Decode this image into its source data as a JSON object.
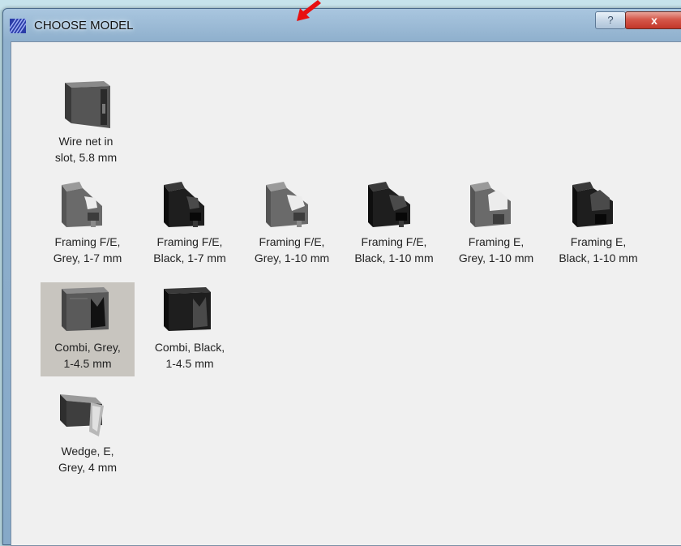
{
  "window": {
    "title": "CHOOSE MODEL",
    "help_label": "?",
    "close_label": "x"
  },
  "models": [
    {
      "id": "wire-net",
      "line1": "Wire net in",
      "line2": "slot, 5.8 mm",
      "color": "#555555",
      "icon": "wire-net-profile-icon"
    },
    {
      "id": "framing-fe-grey-1-7",
      "line1": "Framing F/E,",
      "line2": "Grey, 1-7 mm",
      "color": "#6a6a6a",
      "icon": "framing-profile-icon"
    },
    {
      "id": "framing-fe-black-1-7",
      "line1": "Framing F/E,",
      "line2": "Black, 1-7 mm",
      "color": "#1e1e1e",
      "icon": "framing-profile-icon"
    },
    {
      "id": "framing-fe-grey-1-10",
      "line1": "Framing F/E,",
      "line2": "Grey, 1-10 mm",
      "color": "#6a6a6a",
      "icon": "framing-profile-icon"
    },
    {
      "id": "framing-fe-black-1-10",
      "line1": "Framing F/E,",
      "line2": "Black, 1-10 mm",
      "color": "#1e1e1e",
      "icon": "framing-profile-icon"
    },
    {
      "id": "framing-e-grey-1-10",
      "line1": "Framing E,",
      "line2": "Grey, 1-10 mm",
      "color": "#6a6a6a",
      "icon": "framing-profile-icon"
    },
    {
      "id": "framing-e-black-1-10",
      "line1": "Framing E,",
      "line2": "Black, 1-10 mm",
      "color": "#1e1e1e",
      "icon": "framing-profile-icon"
    },
    {
      "id": "combi-grey",
      "line1": "Combi, Grey,",
      "line2": "1-4.5 mm",
      "color": "#5a5a5a",
      "icon": "combi-profile-icon",
      "selected": true
    },
    {
      "id": "combi-black",
      "line1": "Combi, Black,",
      "line2": "1-4.5 mm",
      "color": "#1e1e1e",
      "icon": "combi-profile-icon"
    },
    {
      "id": "wedge-e-grey",
      "line1": "Wedge, E,",
      "line2": "Grey, 4 mm",
      "color": "#4e4e4e",
      "icon": "wedge-profile-icon"
    }
  ],
  "colors": {
    "selected_bg": "#c8c5bf",
    "client_bg": "#f0f0f0",
    "arrow": "#e81010"
  }
}
